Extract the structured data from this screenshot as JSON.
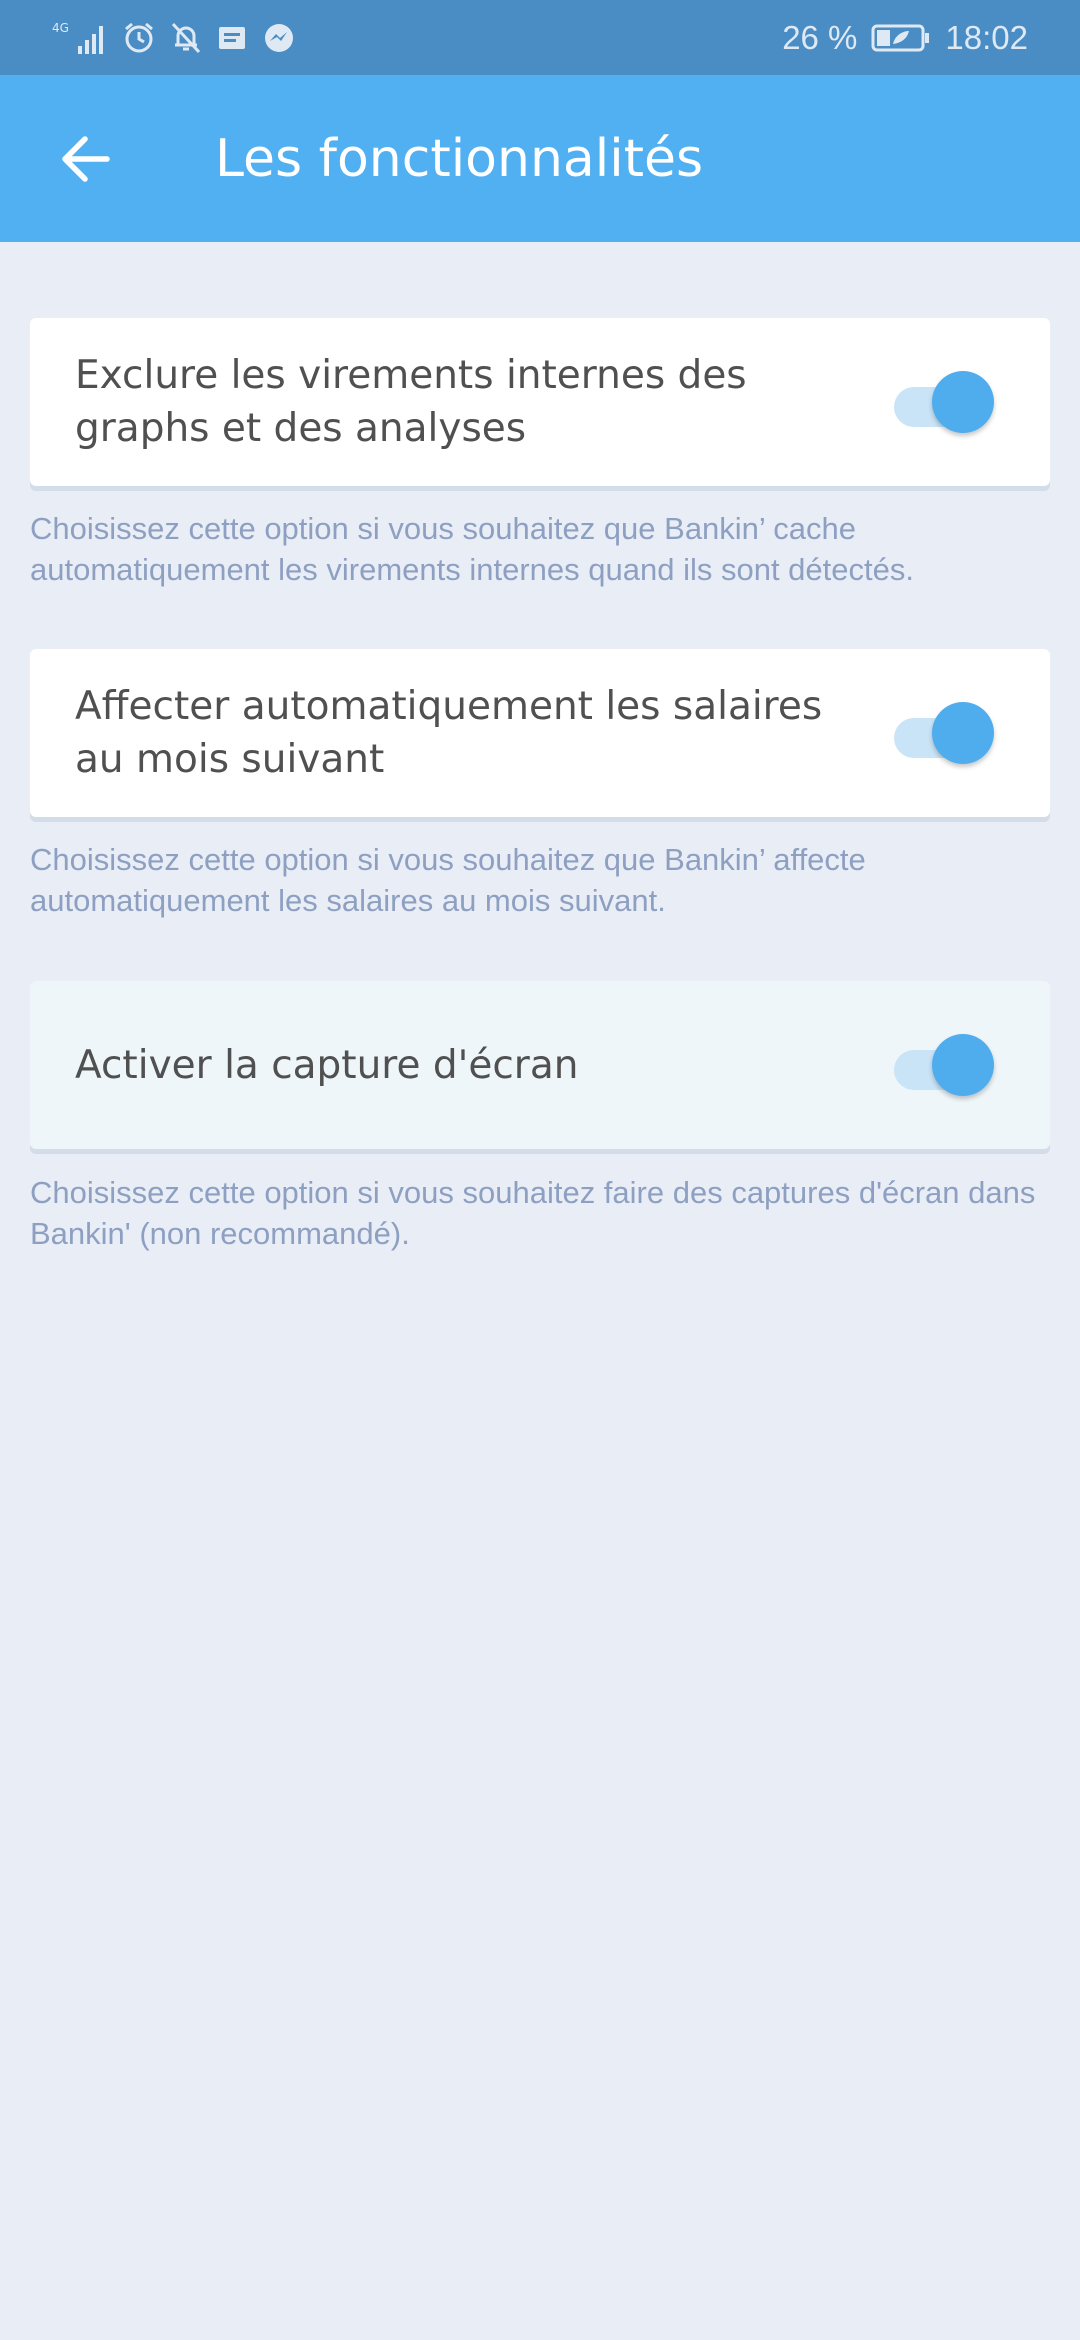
{
  "status_bar": {
    "network": "4G",
    "battery": "26 %",
    "time": "18:02",
    "icons": [
      "signal-icon",
      "alarm-icon",
      "notifications-off-icon",
      "message-icon",
      "messenger-icon",
      "battery-icon"
    ]
  },
  "app_bar": {
    "title": "Les fonctionnalités",
    "back_icon": "arrow-back-icon",
    "background": "#51b0f1"
  },
  "settings": [
    {
      "label": "Exclure les virements internes des graphs et des analyses",
      "enabled": true,
      "hint": "Choisissez cette option si vous souhaitez que Bankin’ cache automatiquement les virements internes quand ils sont détectés."
    },
    {
      "label": "Affecter automatiquement les salaires au mois suivant",
      "enabled": true,
      "hint": "Choisissez cette option si vous souhaitez que Bankin’ affecte automatiquement les salaires au mois suivant."
    },
    {
      "label": "Activer la capture d'écran",
      "enabled": true,
      "hint": "Choisissez cette option si vous souhaitez faire des captures d'écran dans Bankin' (non recommandé)."
    }
  ],
  "colors": {
    "accent": "#4fadee",
    "page_background": "#e9edf6",
    "hint_text": "#8ea0c2"
  }
}
